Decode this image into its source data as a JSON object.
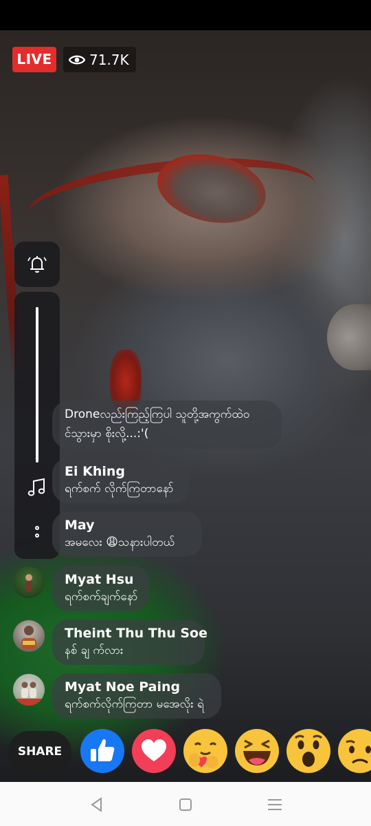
{
  "live": {
    "badge": "LIVE",
    "viewer_count": "71.7K"
  },
  "side_controls": {
    "notification_icon": "bell-icon",
    "volume_slider_level": 1.0,
    "music_icon": "music-note-icon",
    "more_icon": "more-vertical-icon"
  },
  "comments": [
    {
      "name": "",
      "text_line1": "Droneလည်းကြည့်ကြပါ သူတို့အကွက်ထဲဝ",
      "text_line2": "င်သွားမှာ စိုးလို့...:'("
    },
    {
      "name": "Ei Khing",
      "text": "ရက်စက် လိုက်ကြတာနော်"
    },
    {
      "name": "May",
      "text": "အမလေး 😩သနားပါတယ်"
    },
    {
      "name": "Myat Hsu",
      "text": "ရက်စက်ချက်နော်"
    },
    {
      "name": "Theint Thu Thu Soe",
      "text": "နစ် ချ က်လား"
    },
    {
      "name": "Myat Noe Paing",
      "text": "ရက်စက်လိုက်ကြတာ မအေလိုး ရဲ"
    }
  ],
  "bottom": {
    "share_label": "SHARE",
    "reactions": [
      "like-icon",
      "love-icon",
      "care-icon",
      "haha-icon",
      "wow-icon",
      "sad-icon"
    ]
  },
  "navigation": {
    "back_icon": "back-triangle-icon",
    "home_icon": "home-square-icon",
    "menu_icon": "menu-lines-icon"
  },
  "colors": {
    "live_red": "#e42c2c",
    "like_blue": "#1877f2",
    "love_red": "#f33e58",
    "emoji_yellow": "#f7c43b"
  }
}
